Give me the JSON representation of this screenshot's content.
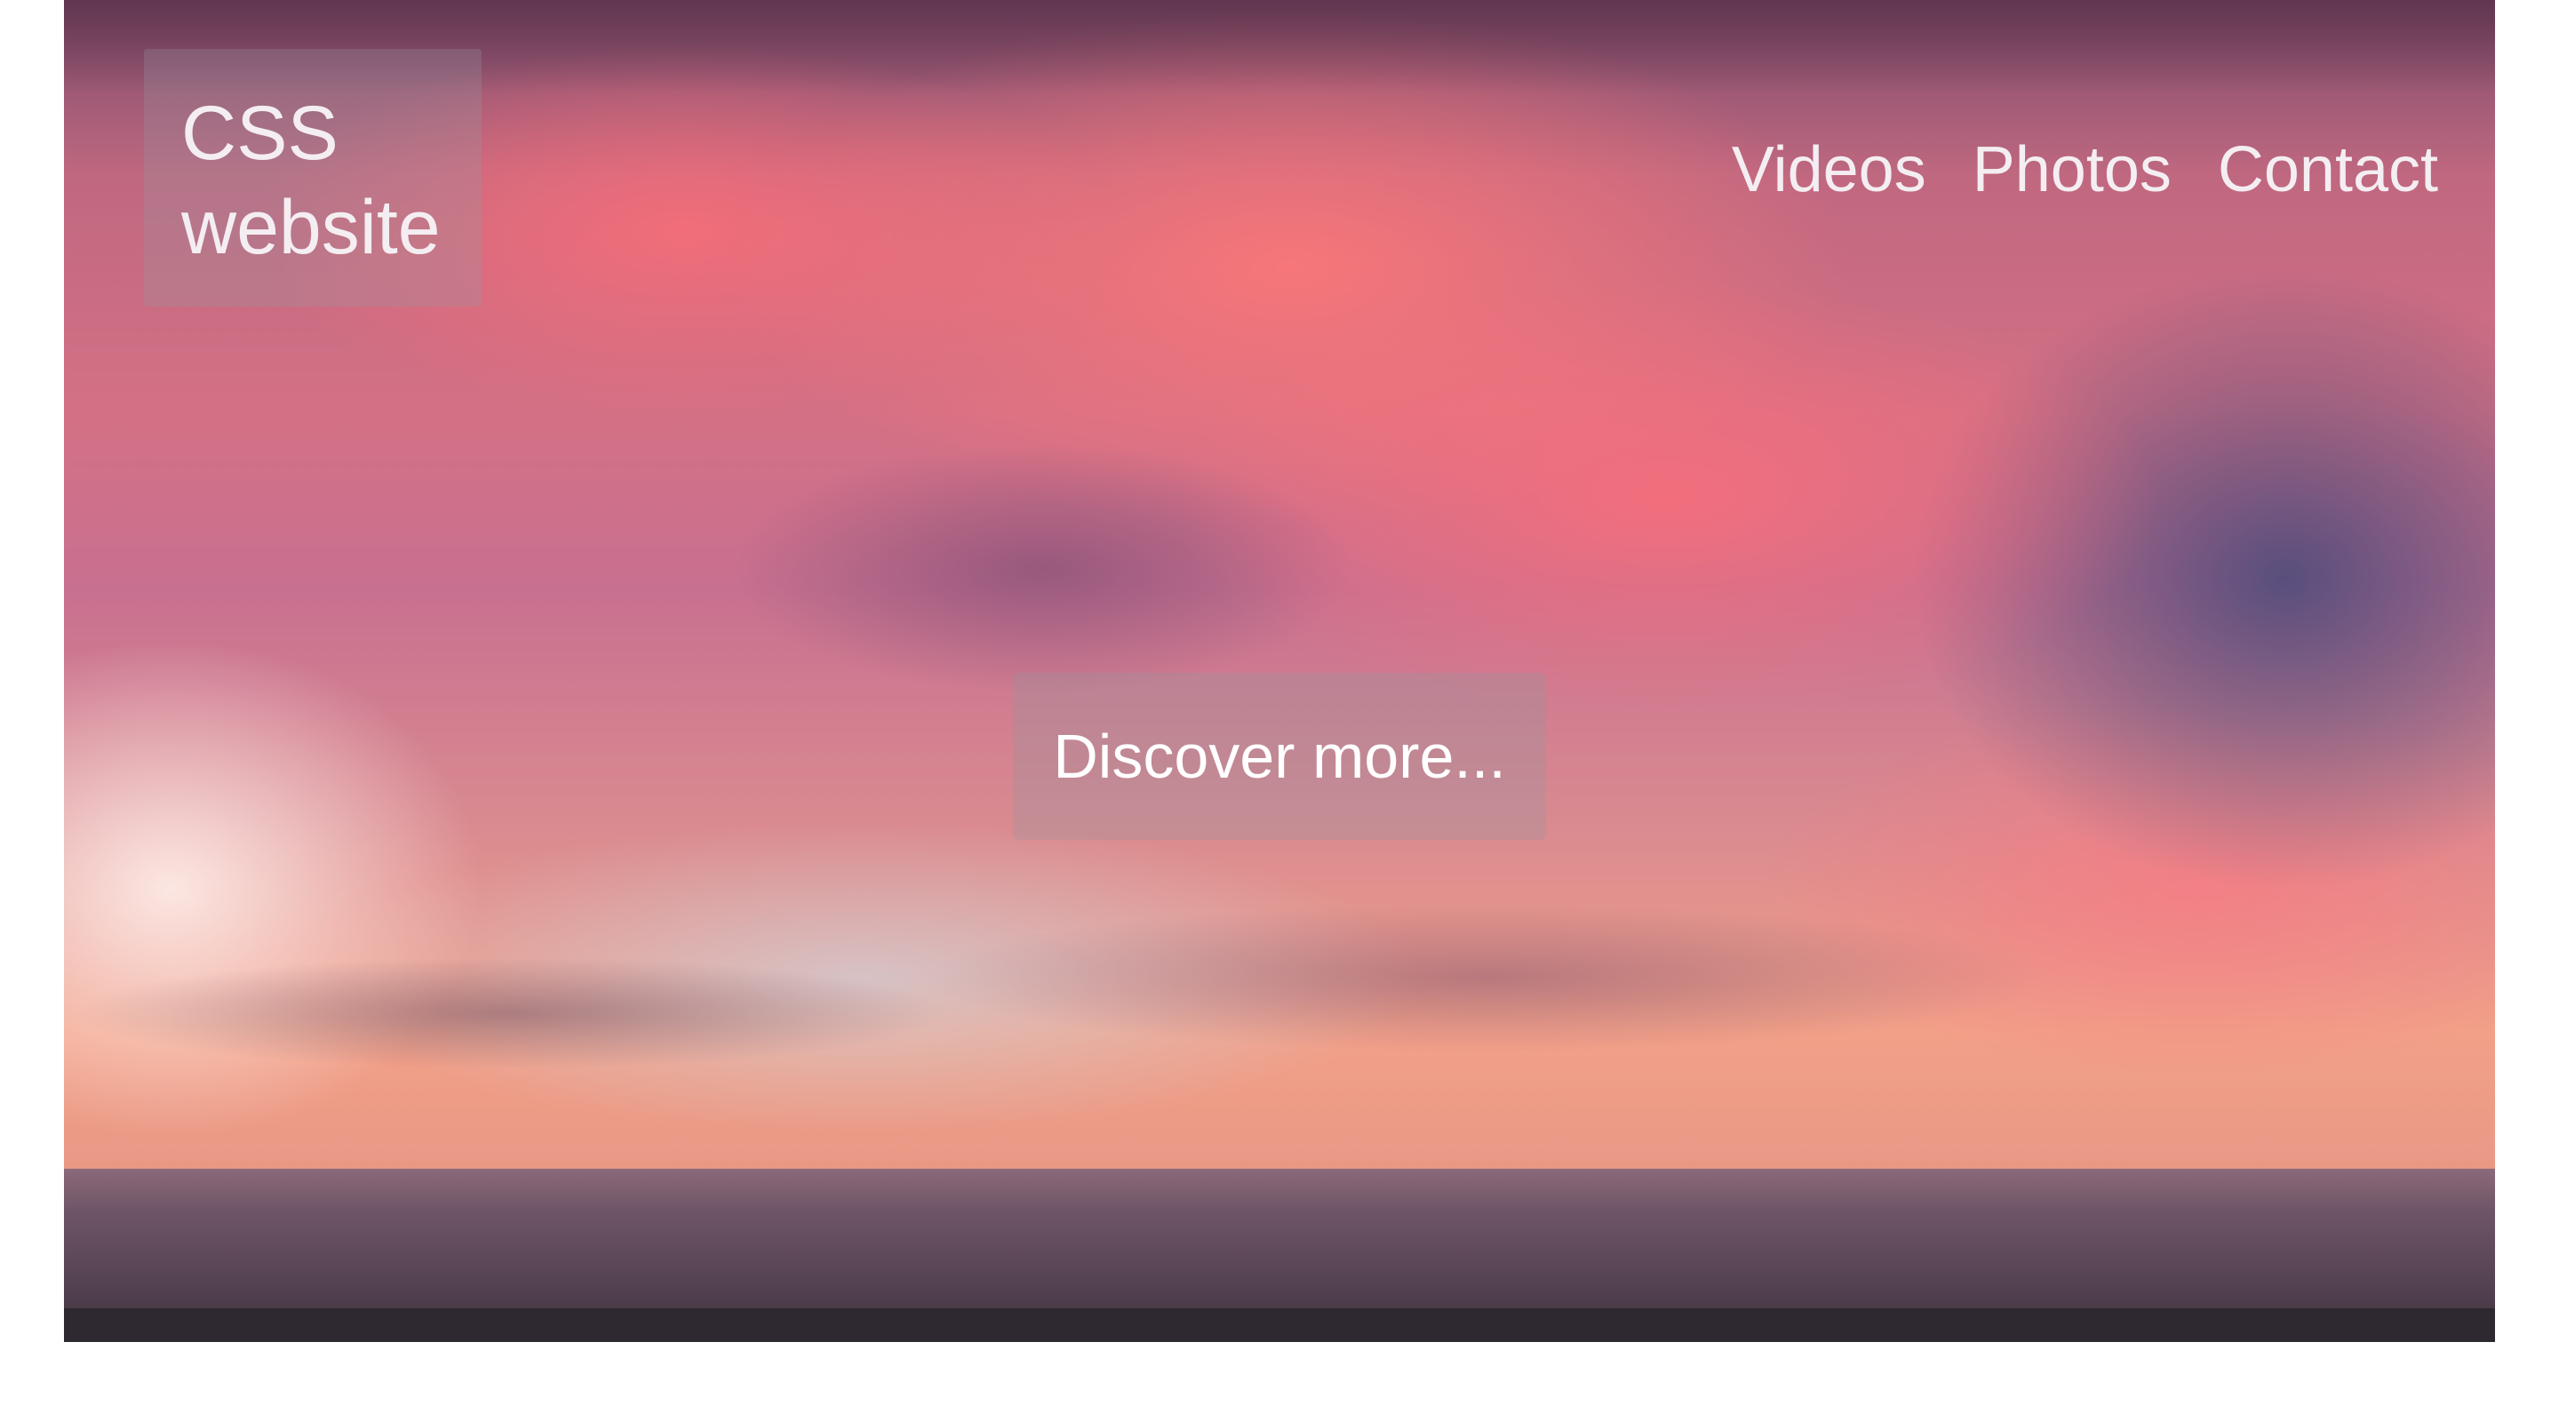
{
  "header": {
    "logo_text": "CSS website"
  },
  "nav": {
    "items": [
      {
        "label": "Videos"
      },
      {
        "label": "Photos"
      },
      {
        "label": "Contact"
      }
    ]
  },
  "hero": {
    "cta_label": "Discover more..."
  },
  "colors": {
    "text": "#f4eef2",
    "overlay": "rgba(150,150,160,0.3)",
    "page_bg": "#ffffff"
  }
}
